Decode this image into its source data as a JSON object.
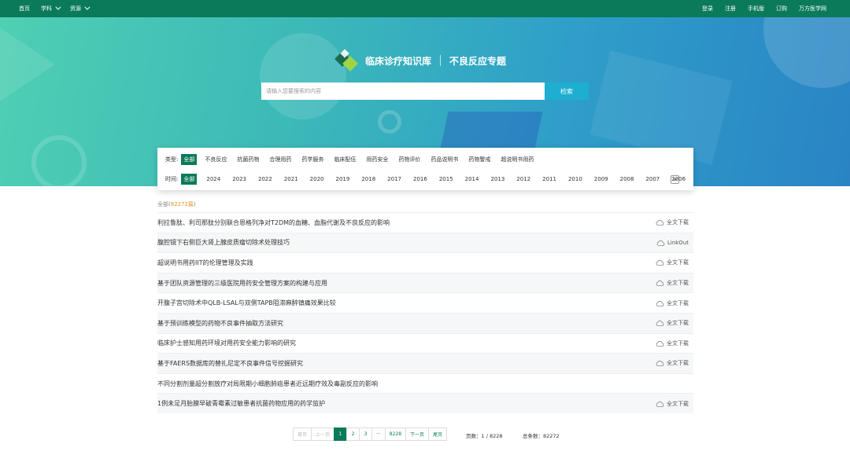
{
  "topnav": {
    "left": [
      "首页",
      "学科",
      "资源"
    ],
    "right": [
      "登录",
      "注册",
      "手机版",
      "订购",
      "万方医学网"
    ]
  },
  "hero": {
    "title": "临床诊疗知识库",
    "subtitle": "不良反应专题",
    "search_placeholder": "请输入您要搜索的内容",
    "search_button": "检索"
  },
  "filters": {
    "type_label": "类型:",
    "types": [
      "全部",
      "不良反应",
      "抗菌药物",
      "合理用药",
      "药学服务",
      "临床配伍",
      "用药安全",
      "药物评价",
      "药品说明书",
      "药物警戒",
      "超说明书用药"
    ],
    "type_selected": "全部",
    "time_label": "时间:",
    "times": [
      "全部",
      "2024",
      "2023",
      "2022",
      "2021",
      "2020",
      "2019",
      "2018",
      "2017",
      "2016",
      "2015",
      "2014",
      "2013",
      "2012",
      "2011",
      "2010",
      "2009",
      "2008",
      "2007",
      "2006"
    ],
    "time_selected": "全部"
  },
  "summary": {
    "label": "全部",
    "count": "82272篇"
  },
  "results": [
    {
      "title": "利拉鲁肽、利司那肽分别联合恩格列净对T2DM的血糖、血脂代谢及不良反应的影响",
      "action": "全文下载"
    },
    {
      "title": "腹腔镜下右侧巨大肾上腺皮质瘤切除术处理技巧",
      "action": "LinkOut"
    },
    {
      "title": "超说明书用药IIT的伦理管理及实践",
      "action": "全文下载"
    },
    {
      "title": "基于团队资源管理的三级医院用药安全管理方案的构建与应用",
      "action": "全文下载"
    },
    {
      "title": "开腹子宫切除术中QLB-LSAL与双侧TAPB阻滞麻醉镇痛效果比较",
      "action": "全文下载"
    },
    {
      "title": "基于预训练模型的药物不良事件抽取方法研究",
      "action": "全文下载"
    },
    {
      "title": "临床护士感知用药环境对用药安全能力影响的研究",
      "action": "全文下载"
    },
    {
      "title": "基于FAERS数据库的替扎尼定不良事件信号挖掘研究",
      "action": "全文下载"
    },
    {
      "title": "不同分割剂量超分割放疗对局限期小细胞肺癌患者近远期疗效及毒副反应的影响",
      "action": ""
    },
    {
      "title": "1例未足月胎膜早破青霉素过敏患者抗菌药物应用的药学监护",
      "action": "全文下载"
    }
  ],
  "pagination": {
    "first": "首页",
    "prev": "上一页",
    "pages": [
      "1",
      "2",
      "3",
      "···",
      "8228"
    ],
    "current": "1",
    "next": "下一页",
    "last": "尾页",
    "page_info": "页数：1 / 8228",
    "total_info": "总条数：82272"
  },
  "colors": {
    "primary_green": "#0b7a5a",
    "search_button": "#1eaed0",
    "count_orange": "#e8952c"
  }
}
